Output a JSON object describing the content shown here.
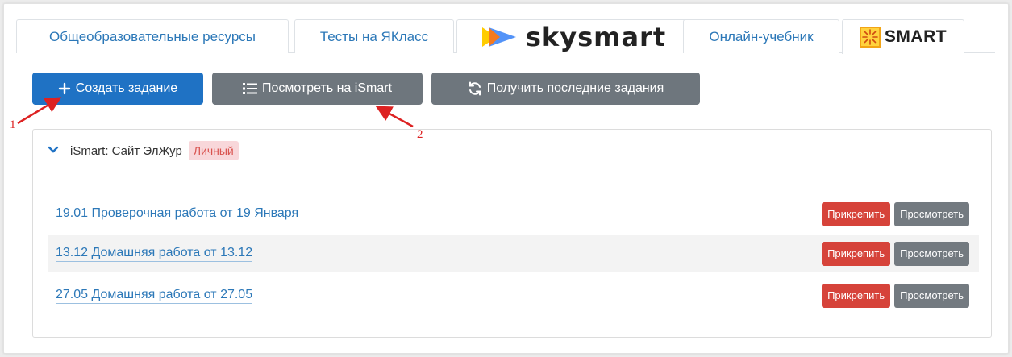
{
  "tabs": [
    {
      "label": "Общеобразовательные ресурсы"
    },
    {
      "label": "Тесты на ЯКласс"
    },
    {
      "label": "skysmart",
      "logo": "skysmart-logo"
    },
    {
      "label": "Онлайн-учебник"
    },
    {
      "label": "SMART",
      "logo": "ismart-logo",
      "active": true
    }
  ],
  "toolbar": {
    "create_label": "Создать задание",
    "view_label": "Посмотреть на iSmart",
    "fetch_label": "Получить последние задания"
  },
  "panel": {
    "title": "iSmart: Сайт ЭлЖур",
    "badge": "Личный"
  },
  "assignments": [
    {
      "title": "19.01 Проверочная работа от 19 Января",
      "attach": "Прикрепить",
      "view": "Просмотреть"
    },
    {
      "title": "13.12 Домашняя работа от 13.12",
      "attach": "Прикрепить",
      "view": "Просмотреть"
    },
    {
      "title": "27.05 Домашняя работа от 27.05",
      "attach": "Прикрепить",
      "view": "Просмотреть"
    }
  ],
  "annotations": [
    {
      "number": "1"
    },
    {
      "number": "2"
    }
  ],
  "colors": {
    "primary": "#1f72c4",
    "secondary": "#6e767d",
    "danger": "#d6433a",
    "link": "#2c78b8",
    "annotation": "#dd2222"
  }
}
